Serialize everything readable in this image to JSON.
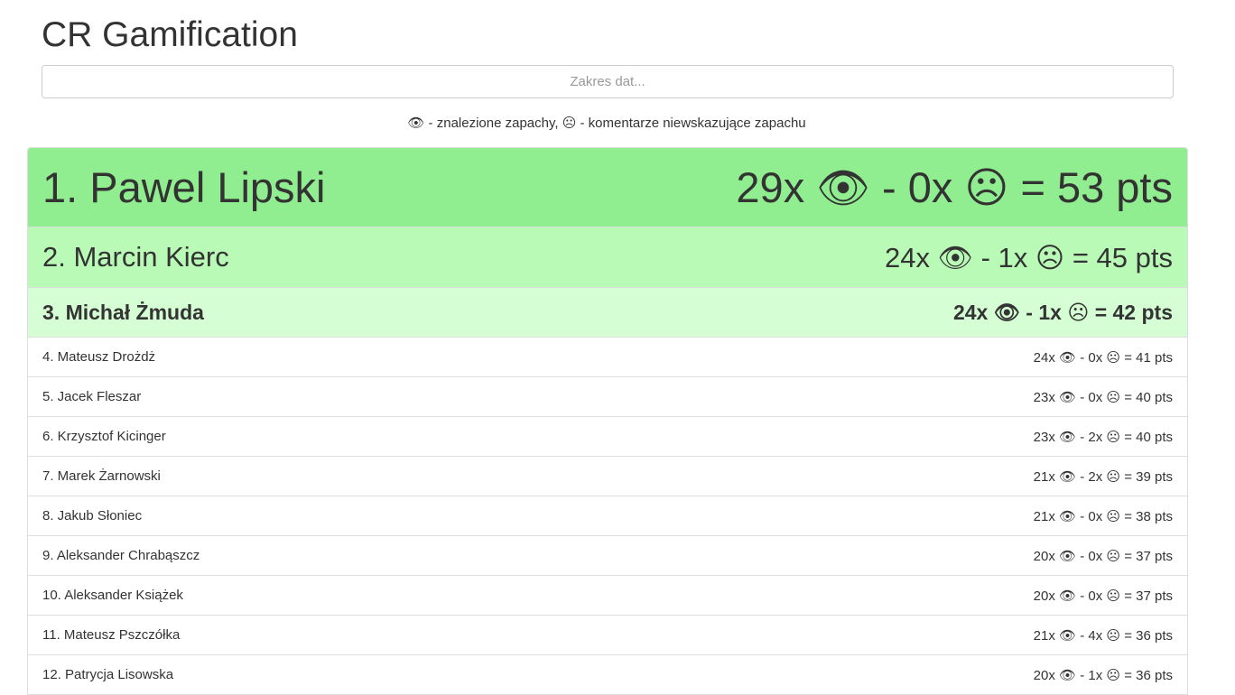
{
  "header": {
    "title": "CR Gamification"
  },
  "date_range": {
    "placeholder": "Zakres dat...",
    "value": ""
  },
  "legend": {
    "eye_icon": "eye-icon",
    "eye_glyph": "👁",
    "found_text": " - znalezione zapachy, ",
    "sad_icon": "sad-face-icon",
    "sad_glyph": "☹",
    "comment_text": " - komentarze niewskazujące zapachu"
  },
  "colors": {
    "rank1_bg": "#90ee90",
    "rank2_bg": "#b9fbb6",
    "rank3_bg": "#d6fed4",
    "row_bg": "#ffffff"
  },
  "leaderboard": [
    {
      "name": "1. Pawel Lipski",
      "score": "29x 👁 - 0x ☹ = 53 pts"
    },
    {
      "name": "2. Marcin Kierc",
      "score": "24x 👁 - 1x ☹ = 45 pts"
    },
    {
      "name": "3. Michał Żmuda",
      "score": "24x 👁 - 1x ☹ = 42 pts"
    },
    {
      "name": "4. Mateusz Drożdż",
      "score": "24x 👁 - 0x ☹ = 41 pts"
    },
    {
      "name": "5. Jacek Fleszar",
      "score": "23x 👁 - 0x ☹ = 40 pts"
    },
    {
      "name": "6. Krzysztof Kicinger",
      "score": "23x 👁 - 2x ☹ = 40 pts"
    },
    {
      "name": "7. Marek Żarnowski",
      "score": "21x 👁 - 2x ☹ = 39 pts"
    },
    {
      "name": "8. Jakub Słoniec",
      "score": "21x 👁 - 0x ☹ = 38 pts"
    },
    {
      "name": "9. Aleksander Chrabąszcz",
      "score": "20x 👁 - 0x ☹ = 37 pts"
    },
    {
      "name": "10. Aleksander Książek",
      "score": "20x 👁 - 0x ☹ = 37 pts"
    },
    {
      "name": "11. Mateusz Pszczółka",
      "score": "21x 👁 - 4x ☹ = 36 pts"
    },
    {
      "name": "12. Patrycja Lisowska",
      "score": "20x 👁 - 1x ☹ = 36 pts"
    }
  ]
}
